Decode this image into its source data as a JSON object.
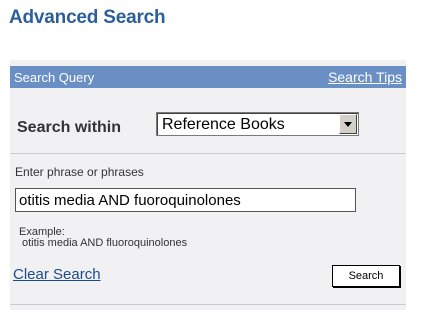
{
  "page": {
    "title": "Advanced Search"
  },
  "panel": {
    "header_title": "Search Query",
    "search_tips_link": "Search Tips",
    "search_within_label": "Search within",
    "search_within_value": "Reference Books",
    "phrase_label": "Enter phrase or phrases",
    "phrase_value": "otitis media AND fuoroquinolones",
    "example_label": "Example:",
    "example_text": "otitis media AND fluoroquinolones",
    "clear_search_link": "Clear Search",
    "search_button": "Search"
  },
  "colors": {
    "title": "#2b5f9b",
    "header_bar": "#6a8fc4",
    "panel_background": "#f1f0f3",
    "link": "#1b4d8a"
  },
  "icons": {
    "dropdown": "chevron-down-icon"
  }
}
